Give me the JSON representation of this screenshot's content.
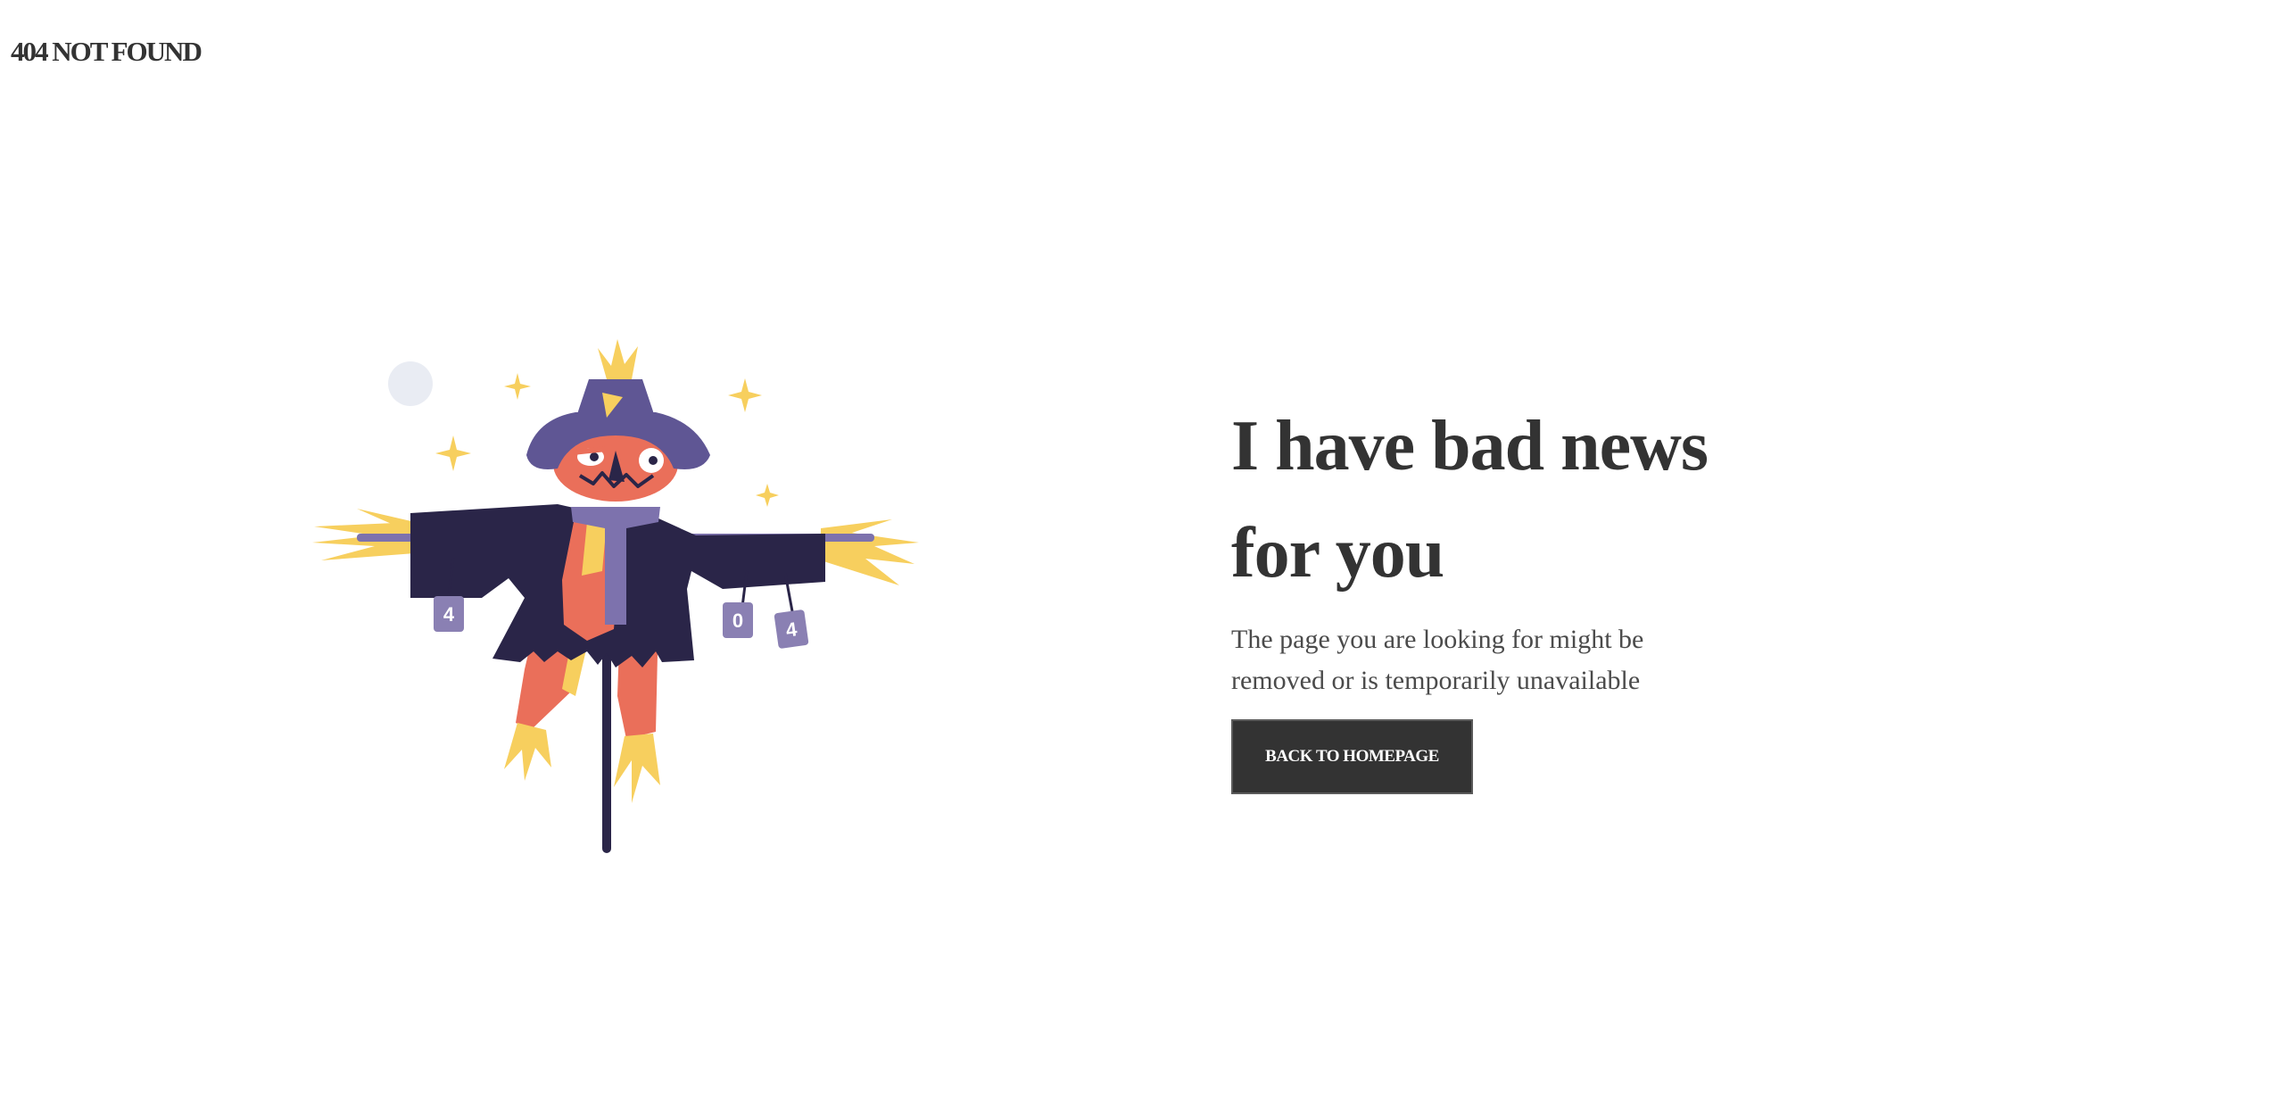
{
  "header": {
    "logo_text": "404 NOT FOUND"
  },
  "main": {
    "headline_line1": "I have bad news",
    "headline_line2": "for you",
    "subtext_line1": "The page you are looking for might be",
    "subtext_line2": "removed or is temporarily unavailable",
    "button_label": "BACK TO HOMEPAGE"
  },
  "illustration": {
    "can_labels": [
      "4",
      "0",
      "4"
    ]
  },
  "colors": {
    "text_dark": "#333333",
    "button_bg": "#333333",
    "coat": "#2a2548",
    "hat": "#5f5694",
    "skin": "#ea6f5a",
    "straw": "#f7cf5e",
    "can": "#8a80b3",
    "moon": "#e9ecf3"
  }
}
